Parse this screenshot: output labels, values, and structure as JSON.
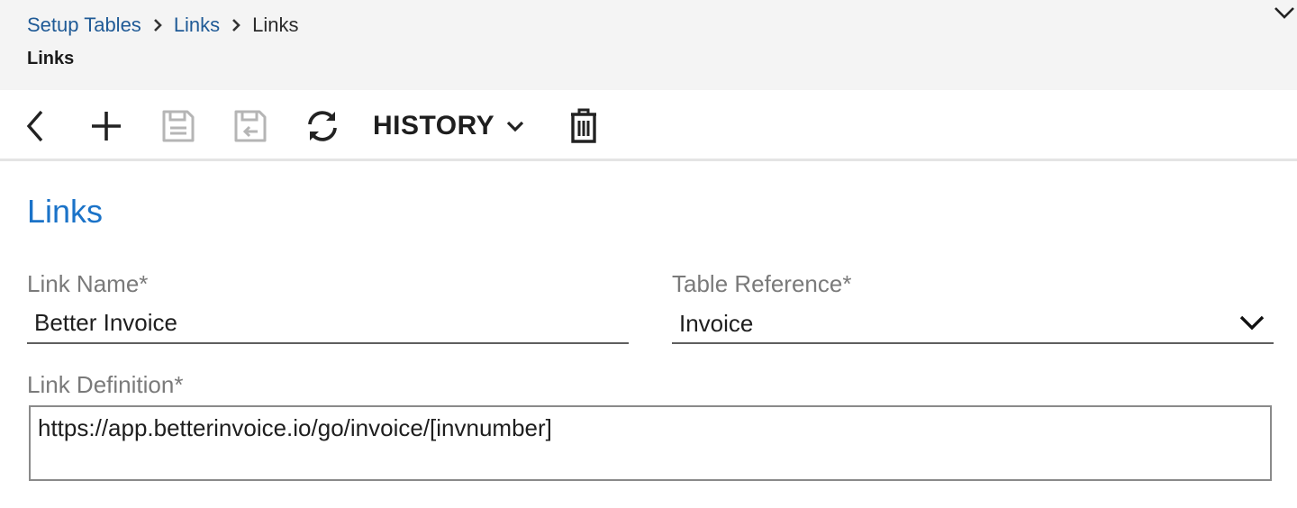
{
  "breadcrumb": {
    "items": [
      "Setup Tables",
      "Links",
      "Links"
    ]
  },
  "header": {
    "title": "Links"
  },
  "toolbar": {
    "history_label": "HISTORY",
    "icons": {
      "back": "back-icon",
      "add": "add-icon",
      "save": "save-icon",
      "save_and_close": "save-and-close-icon",
      "refresh": "refresh-icon",
      "history_dropdown": "chevron-down-icon",
      "delete": "trash-icon"
    },
    "disabled": [
      "save",
      "save_and_close"
    ]
  },
  "form": {
    "section_title": "Links",
    "link_name": {
      "label": "Link Name*",
      "value": "Better Invoice"
    },
    "table_reference": {
      "label": "Table Reference*",
      "value": "Invoice"
    },
    "link_definition": {
      "label": "Link Definition*",
      "value": "https://app.betterinvoice.io/go/invoice/[invnumber]"
    }
  },
  "colors": {
    "breadcrumb_link": "#1f5a96",
    "section_title": "#1b73c8",
    "label": "#7a7a7a",
    "header_bg": "#f4f4f4",
    "disabled_icon": "#b5b5b5"
  }
}
